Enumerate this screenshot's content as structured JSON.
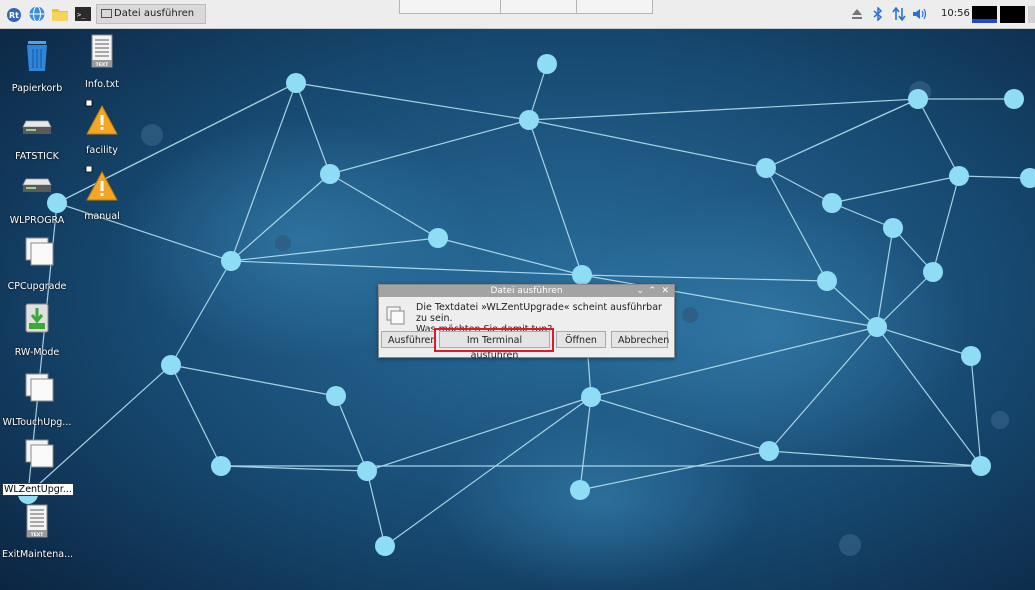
{
  "taskbar": {
    "task_title": "Datei ausführen",
    "clock": "10:56",
    "launchers": [
      "raspberry-menu-icon",
      "web-browser-icon",
      "file-manager-icon",
      "terminal-icon"
    ],
    "tray": [
      "eject-icon",
      "bluetooth-icon",
      "network-icon",
      "volume-icon"
    ]
  },
  "desktop": {
    "icons": [
      {
        "label": "Papierkorb",
        "icon": "trash-icon"
      },
      {
        "label": "Info.txt",
        "icon": "text-file-icon"
      },
      {
        "label": "FATSTICK",
        "icon": "drive-icon"
      },
      {
        "label": "facility",
        "icon": "warning-icon"
      },
      {
        "label": "WLPROGRA",
        "icon": "drive-icon"
      },
      {
        "label": "manual",
        "icon": "warning-icon"
      },
      {
        "label": "CPCupgrade",
        "icon": "generic-file-icon"
      },
      {
        "label": "RW-Mode",
        "icon": "install-icon"
      },
      {
        "label": "WLTouchUpg...",
        "icon": "generic-file-icon"
      },
      {
        "label": "WLZentUpgr...",
        "icon": "generic-file-icon"
      },
      {
        "label": "ExitMaintena...",
        "icon": "text-file-icon"
      }
    ],
    "file_badge": "TEXT"
  },
  "dialog": {
    "title": "Datei ausführen",
    "message_line1": "Die Textdatei »WLZentUpgrade« scheint ausführbar zu sein.",
    "message_line2": "Was möchten Sie damit tun?",
    "buttons": {
      "run": "Ausführen",
      "run_in_terminal": "Im Terminal ausführen",
      "open": "Öffnen",
      "cancel": "Abbrechen"
    },
    "highlighted_button": "run_in_terminal",
    "highlight_color": "#e0192a"
  },
  "colors": {
    "wallpaper_dark": "#0b2440",
    "wallpaper_mid": "#1f5a86",
    "node_color": "#8fdcf5",
    "taskbar_bg": "#ededed"
  }
}
